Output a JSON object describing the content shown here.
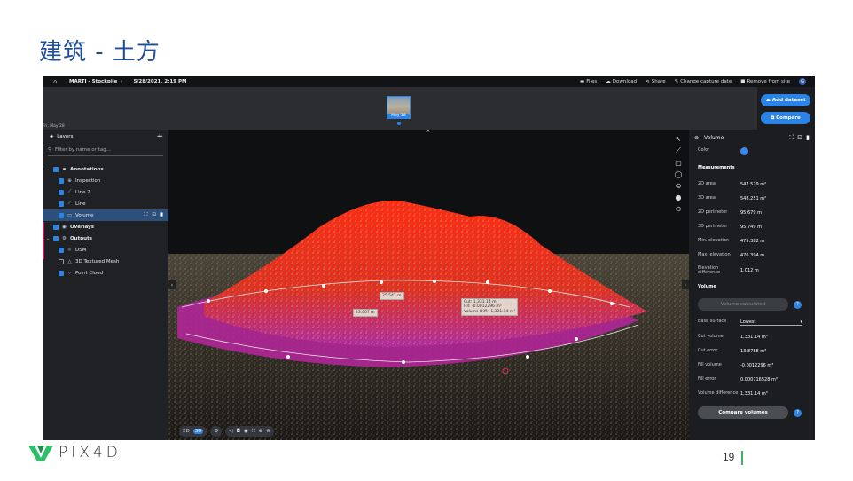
{
  "slide": {
    "title": "建筑 - 土方",
    "page_number": "19",
    "logo_text": "PIX4D"
  },
  "topbar": {
    "project": "MARTI - Stockpile",
    "date": "5/28/2021, 2:19 PM",
    "actions": [
      "Files",
      "Download",
      "Share",
      "Change capture date",
      "Remove from site"
    ],
    "avatar": "G"
  },
  "timeline": {
    "date_left": "Fri, May 28",
    "thumb_label": "May 28"
  },
  "side_actions": {
    "add_dataset": "Add dataset",
    "compare": "Compare"
  },
  "layers": {
    "title": "Layers",
    "filter_placeholder": "Filter by name or tag...",
    "annotations": "Annotations",
    "inspection": "Inspection",
    "line2": "Line 2",
    "line": "Line",
    "volume": "Volume",
    "overlays": "Overlays",
    "outputs": "Outputs",
    "dsm": "DSM",
    "mesh": "3D Textured Mesh",
    "pointcloud": "Point Cloud"
  },
  "viewport": {
    "label_left": "25.541 m",
    "label_mid": "23.007 m",
    "label_cut": "Cut: 1,331.14 m³",
    "label_fill": "Fill: -0.0012296 m³",
    "label_vdiff": "Volume Diff.: 1,331.14 m³",
    "mode_2d": "2D",
    "mode_3d": "3D"
  },
  "volume_panel": {
    "title": "Volume",
    "color_label": "Color",
    "measurements_title": "Measurements",
    "area2d_k": "2D area",
    "area2d_v": "547.579 m²",
    "area3d_k": "3D area",
    "area3d_v": "548.251 m²",
    "perim2d_k": "2D perimeter",
    "perim2d_v": "95.679 m",
    "perim3d_k": "3D perimeter",
    "perim3d_v": "95.749 m",
    "minel_k": "Min. elevation",
    "minel_v": "475.382 m",
    "maxel_k": "Max. elevation",
    "maxel_v": "476.394 m",
    "eldiff_k": "Elevation difference",
    "eldiff_v": "1.012 m",
    "volume_title": "Volume",
    "calc_button": "Volume calculated",
    "base_k": "Base surface",
    "base_v": "Lowest",
    "cutvol_k": "Cut volume",
    "cutvol_v": "1,331.14 m³",
    "cuterr_k": "Cut error",
    "cuterr_v": "13.8788 m³",
    "fillvol_k": "Fill volume",
    "fillvol_v": "-0.0012296 m³",
    "fillerr_k": "Fill error",
    "fillerr_v": "0.000716528 m³",
    "voldiff_k": "Volume difference",
    "voldiff_v": "1,331.14 m³",
    "compare_button": "Compare volumes"
  }
}
